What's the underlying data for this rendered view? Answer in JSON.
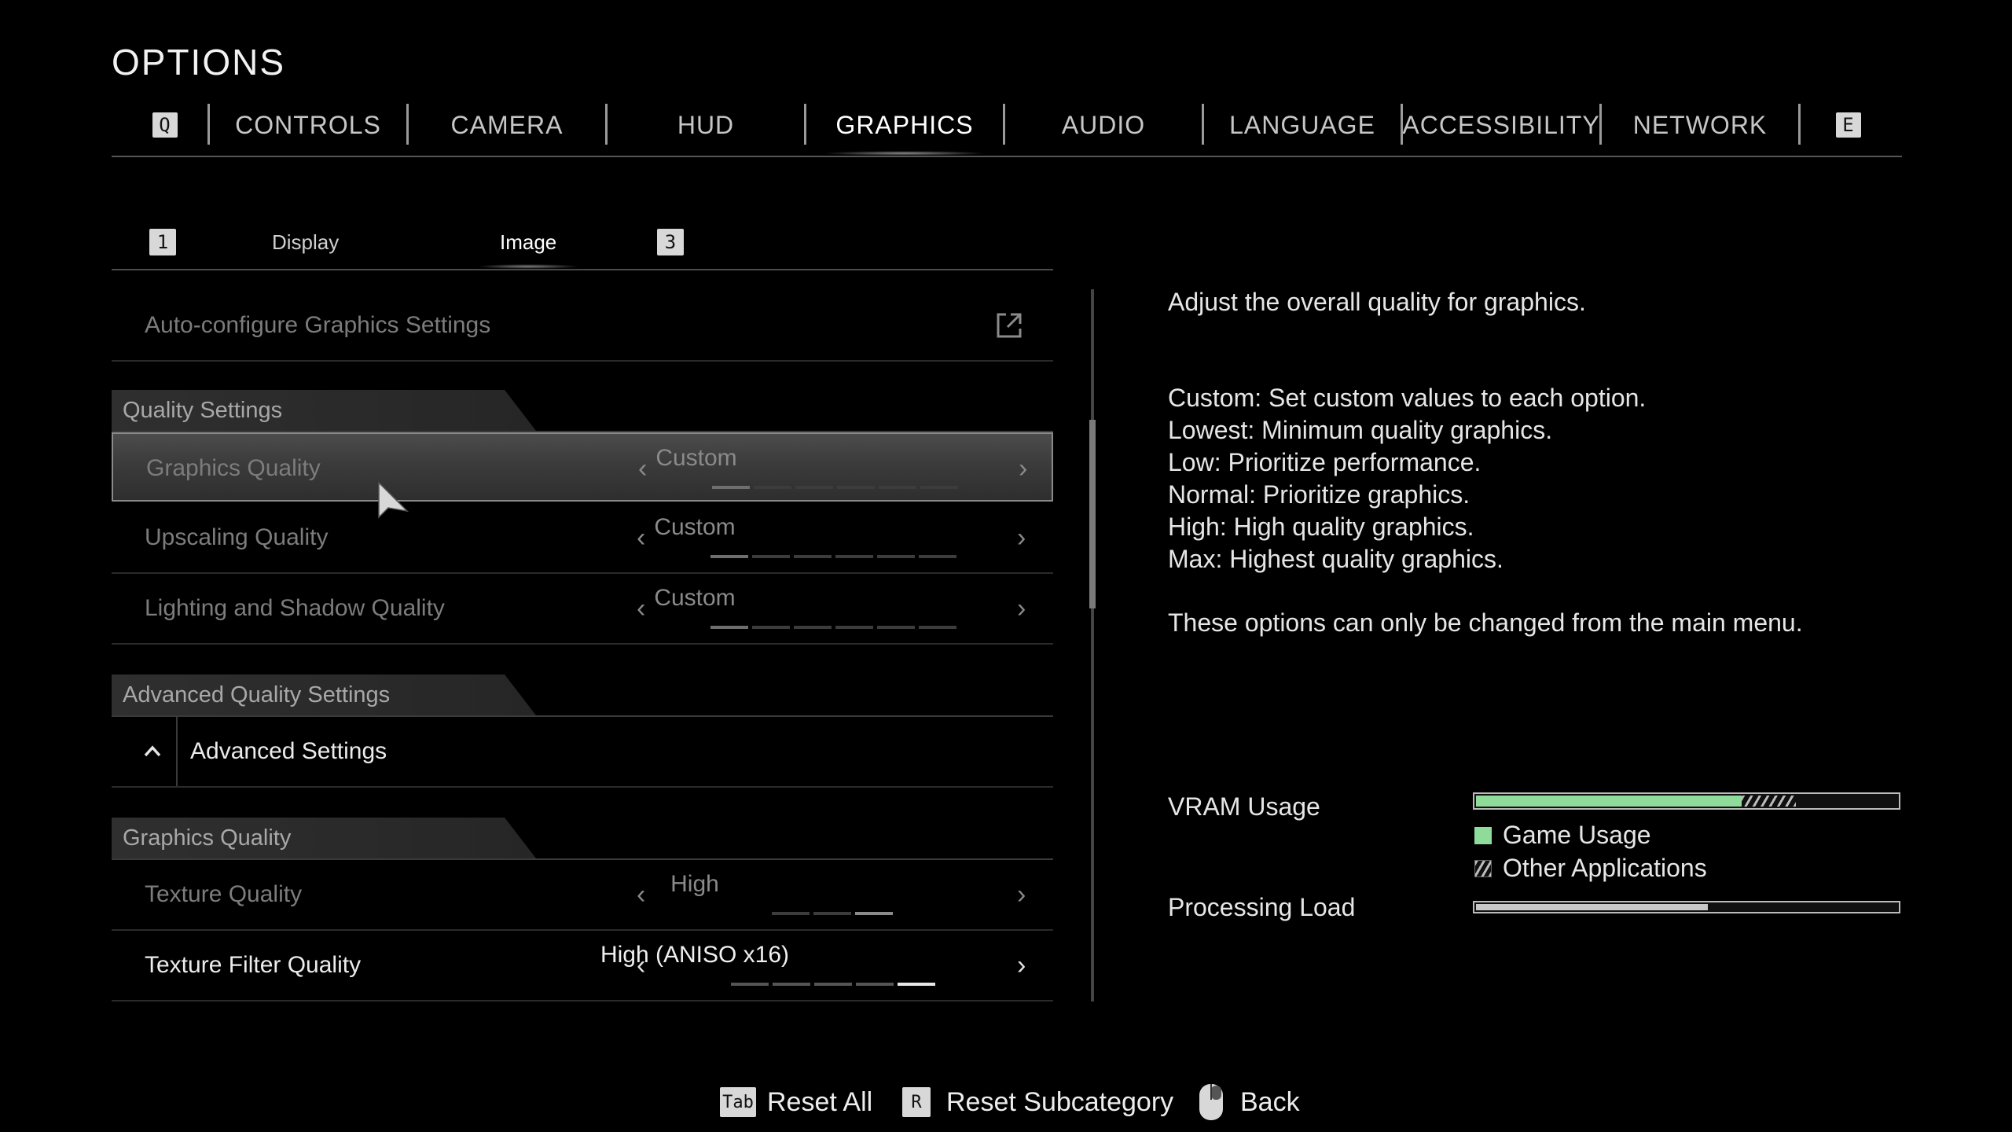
{
  "title": "OPTIONS",
  "tabs": {
    "left_key": "Q",
    "right_key": "E",
    "items": [
      "CONTROLS",
      "CAMERA",
      "HUD",
      "GRAPHICS",
      "AUDIO",
      "LANGUAGE",
      "ACCESSIBILITY",
      "NETWORK"
    ],
    "active": "GRAPHICS"
  },
  "subtabs": {
    "left_key": "1",
    "right_key": "3",
    "items": [
      "Display",
      "Image"
    ],
    "active": "Image"
  },
  "auto_configure": "Auto-configure Graphics Settings",
  "sections": {
    "quality": "Quality Settings",
    "advanced": "Advanced Quality Settings",
    "graphics_quality": "Graphics Quality"
  },
  "rows": {
    "graphics_quality": {
      "label": "Graphics Quality",
      "value": "Custom",
      "level": 1,
      "steps": 6
    },
    "upscaling_quality": {
      "label": "Upscaling Quality",
      "value": "Custom",
      "level": 1,
      "steps": 6
    },
    "lighting_shadow_quality": {
      "label": "Lighting and Shadow Quality",
      "value": "Custom",
      "level": 1,
      "steps": 6
    },
    "texture_quality": {
      "label": "Texture Quality",
      "value": "High",
      "level": 3,
      "steps": 3
    },
    "texture_filter_quality": {
      "label": "Texture Filter Quality",
      "value": "High (ANISO x16)",
      "level": 5,
      "steps": 5
    }
  },
  "advanced_settings": "Advanced Settings",
  "description": {
    "heading": "Adjust the overall quality for graphics.",
    "lines": [
      "Custom: Set custom values to each option.",
      "Lowest: Minimum quality graphics.",
      "Low: Prioritize performance.",
      "Normal: Prioritize graphics.",
      "High: High quality graphics.",
      "Max: Highest quality graphics."
    ],
    "note": "These options can only be changed from the main menu."
  },
  "meters": {
    "vram_label": "VRAM Usage",
    "vram_game_fraction": 0.63,
    "vram_other_fraction": 0.13,
    "legend_game": "Game Usage",
    "legend_other": "Other Applications",
    "processing_label": "Processing Load",
    "processing_fraction": 0.55,
    "game_color": "#8fdc9a"
  },
  "footer": {
    "reset_all_key": "Tab",
    "reset_all": "Reset All",
    "reset_sub_key": "R",
    "reset_sub": "Reset Subcategory",
    "back": "Back"
  }
}
